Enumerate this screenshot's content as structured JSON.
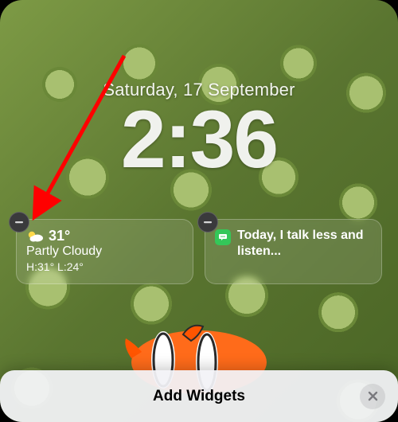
{
  "lockscreen": {
    "date": "Saturday, 17 September",
    "time": "2:36"
  },
  "widgets": {
    "weather": {
      "icon_name": "partly-cloudy-icon",
      "temperature": "31°",
      "condition": "Partly Cloudy",
      "high_low": "H:31° L:24°"
    },
    "quote": {
      "icon_name": "speech-bubble-icon",
      "text": "Today, I talk less and listen..."
    }
  },
  "sheet": {
    "title": "Add Widgets"
  },
  "colors": {
    "remove_button_bg": "#3a3a3c",
    "quote_icon_bg": "#34c759",
    "annotation_arrow": "#ff0000"
  }
}
